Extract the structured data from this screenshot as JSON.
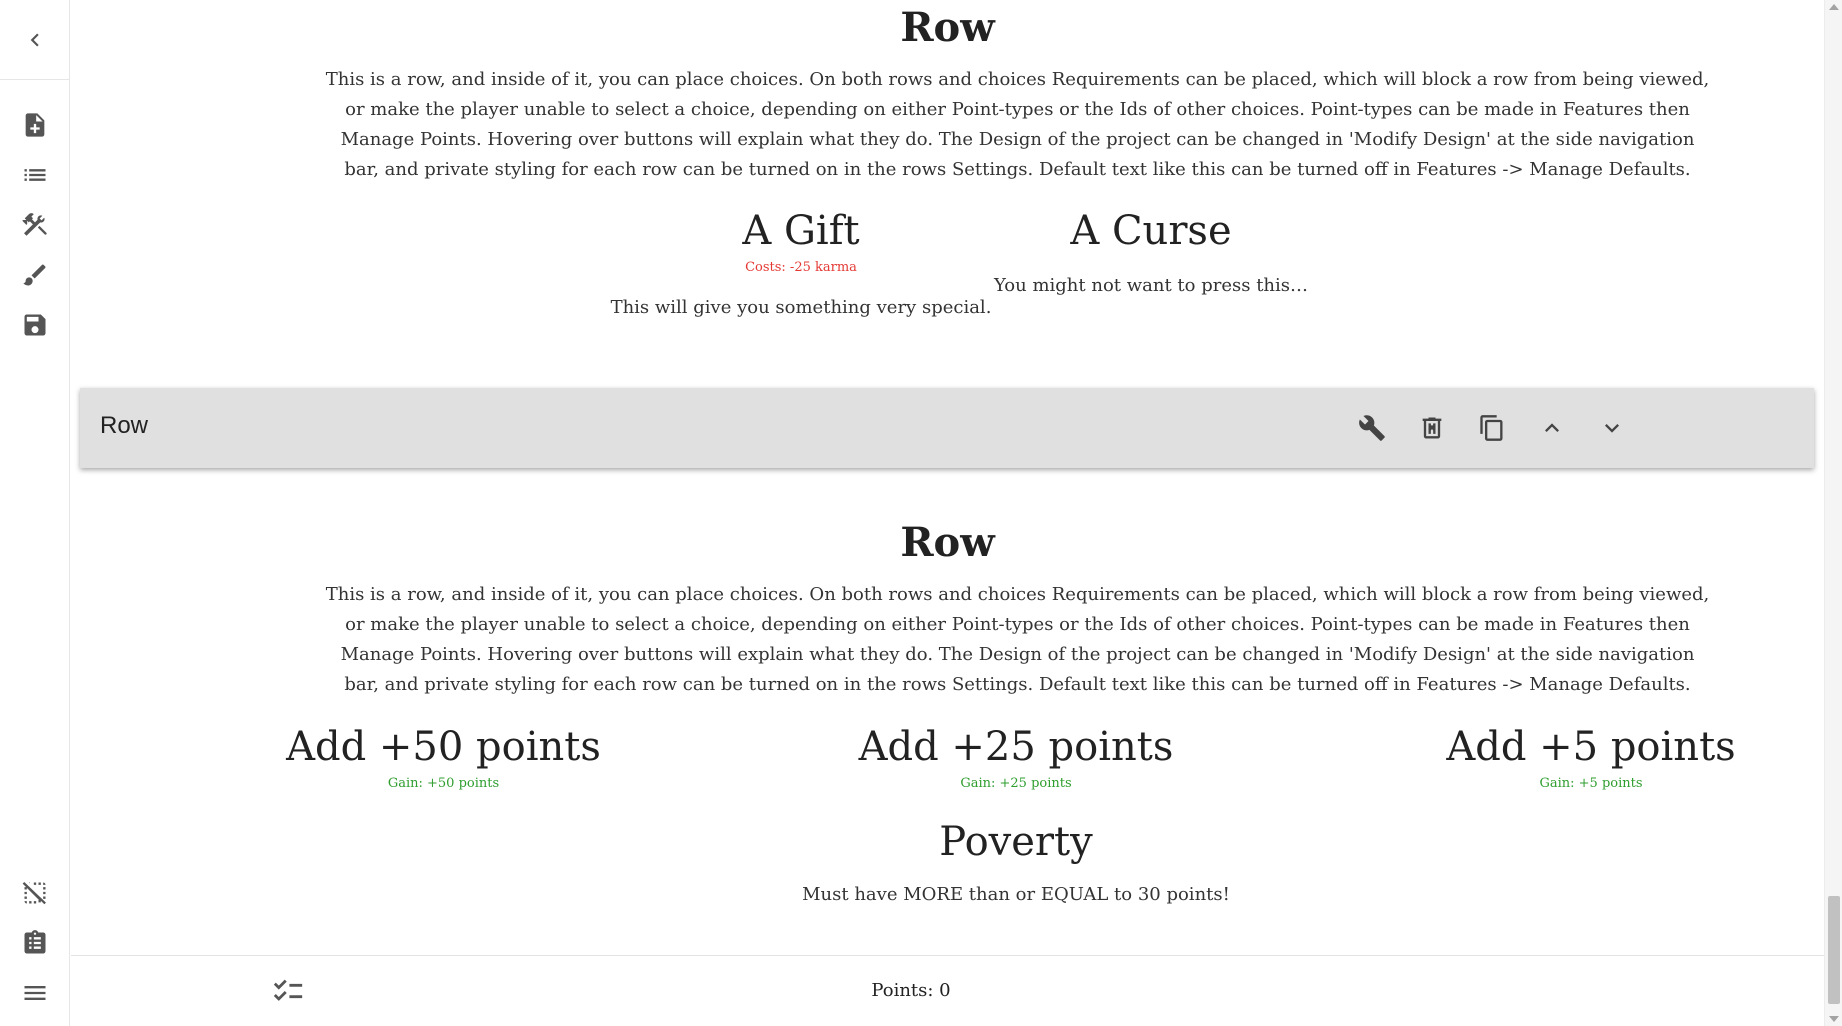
{
  "sidebar": {
    "icons": [
      "chevron-left-icon",
      "new-file-icon",
      "list-icon",
      "tools-icon",
      "brush-icon",
      "save-icon",
      "deselect-icon",
      "clipboard-icon",
      "menu-icon"
    ]
  },
  "section1": {
    "title": "Row",
    "description": "This is a row, and inside of it, you can place choices. On both rows and choices Requirements can be placed, which will block a row from being viewed, or make the player unable to select a choice, depending on either Point-types or the Ids of other choices. Point-types can be made in Features then Manage Points. Hovering over buttons will explain what they do. The Design of the project can be changed in 'Modify Design' at the side navigation bar, and private styling for each row can be turned on in the rows Settings. Default text like this can be turned off in Features -> Manage Defaults.",
    "choices": [
      {
        "title": "A Gift",
        "cost": "Costs: -25  karma",
        "text": "This will give you something very special."
      },
      {
        "title": "A Curse",
        "text": "You might not want to press this…"
      }
    ]
  },
  "row_bar": {
    "label": "Row",
    "buttons": [
      "wrench-icon",
      "delete-icon",
      "copy-icon",
      "chevron-up-icon",
      "chevron-down-icon"
    ]
  },
  "section2": {
    "title": "Row",
    "description": "This is a row, and inside of it, you can place choices. On both rows and choices Requirements can be placed, which will block a row from being viewed, or make the player unable to select a choice, depending on either Point-types or the Ids of other choices. Point-types can be made in Features then Manage Points. Hovering over buttons will explain what they do. The Design of the project can be changed in 'Modify Design' at the side navigation bar, and private styling for each row can be turned on in the rows Settings. Default text like this can be turned off in Features -> Manage Defaults.",
    "choices": [
      {
        "title": "Add +50 points",
        "gain": "Gain: +50  points"
      },
      {
        "title": "Add +25 points",
        "gain": "Gain: +25  points"
      },
      {
        "title": "Add +5 points",
        "gain": "Gain: +5  points"
      },
      {
        "title": "Poverty",
        "text": "Must have MORE than or EQUAL to 30 points!"
      }
    ]
  },
  "bottom_bar": {
    "points": "Points: 0"
  },
  "colors": {
    "cost": "#e53935",
    "gain": "#2e9e2e",
    "row_bar_bg": "#e0e0e0"
  }
}
